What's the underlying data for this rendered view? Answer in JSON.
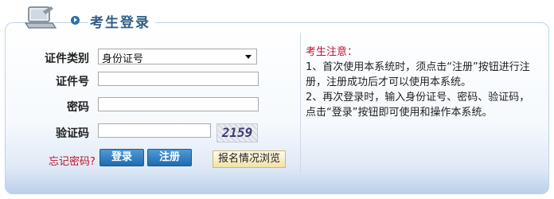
{
  "header": {
    "title": "考生登录",
    "icon": "laptop-icon"
  },
  "form": {
    "cert_type_label": "证件类别",
    "cert_type_value": "身份证号",
    "cert_no_label": "证件号",
    "cert_no_value": "",
    "password_label": "密码",
    "password_value": "",
    "captcha_label": "验证码",
    "captcha_value": "",
    "captcha_text": "2159"
  },
  "actions": {
    "forgot_password": "忘记密码?",
    "login": "登录",
    "register": "注册",
    "browse": "报名情况浏览"
  },
  "notice": {
    "title": "考生注意：",
    "item1": "1、首次使用本系统时，须点击“注册”按钮进行注册，注册成功后才可以使用本系统。",
    "item2": "2、再次登录时，输入身份证号、密码、验证码，点击“登录”按钮即可使用和操作本系统。"
  },
  "colors": {
    "accent": "#2f5f86",
    "button_blue": "#1f6bb0",
    "warning_red": "#c0122b"
  }
}
